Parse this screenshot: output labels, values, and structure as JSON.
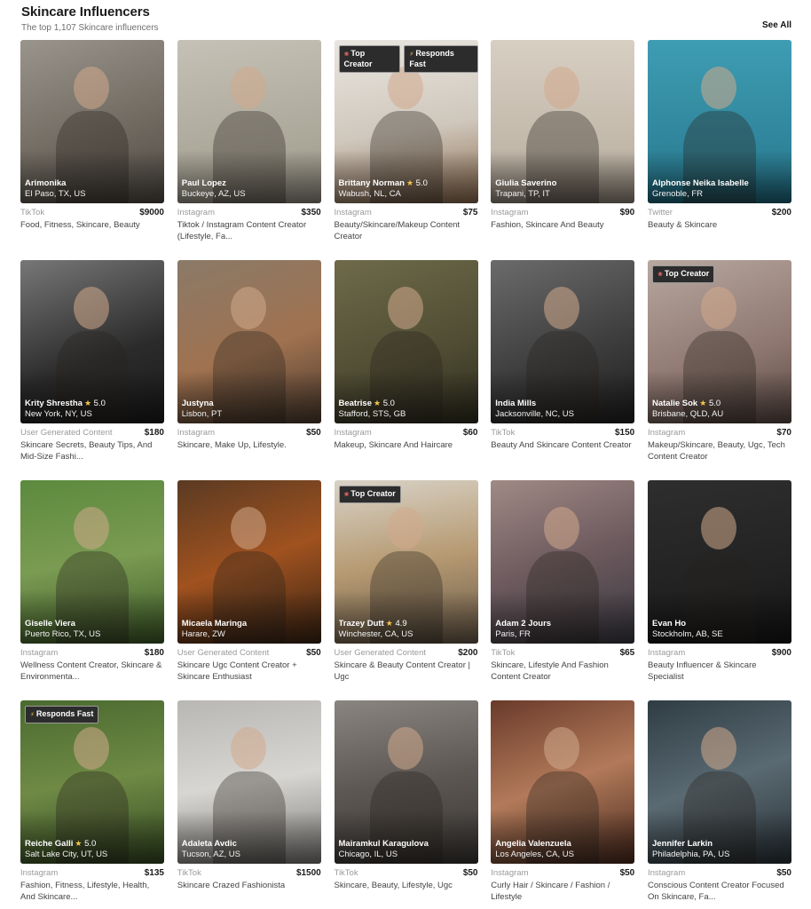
{
  "header": {
    "title": "Skincare Influencers",
    "subtitle": "The top 1,107 Skincare influencers",
    "see_all": "See All"
  },
  "badges": {
    "top_creator": "Top Creator",
    "responds_fast": "Responds Fast"
  },
  "influencers": [
    {
      "name": "Arimonika",
      "rating": "",
      "location": "El Paso, TX, US",
      "platform": "TikTok",
      "price": "$9000",
      "description": "Food, Fitness, Skincare, Beauty",
      "badges": []
    },
    {
      "name": "Paul Lopez",
      "rating": "",
      "location": "Buckeye, AZ, US",
      "platform": "Instagram",
      "price": "$350",
      "description": "Tiktok / Instagram Content Creator (Lifestyle, Fa...",
      "badges": []
    },
    {
      "name": "Brittany Norman",
      "rating": "5.0",
      "location": "Wabush, NL, CA",
      "platform": "Instagram",
      "price": "$75",
      "description": "Beauty/Skincare/Makeup Content Creator",
      "badges": [
        "top_creator",
        "responds_fast"
      ]
    },
    {
      "name": "Giulia Saverino",
      "rating": "",
      "location": "Trapani, TP, IT",
      "platform": "Instagram",
      "price": "$90",
      "description": "Fashion, Skincare And Beauty",
      "badges": []
    },
    {
      "name": "Alphonse Neika Isabelle",
      "rating": "",
      "location": "Grenoble, FR",
      "platform": "Twitter",
      "price": "$200",
      "description": "Beauty & Skincare",
      "badges": []
    },
    {
      "name": "Krity Shrestha",
      "rating": "5.0",
      "location": "New York, NY, US",
      "platform": "User Generated Content",
      "price": "$180",
      "description": "Skincare Secrets, Beauty Tips, And Mid-Size Fashi...",
      "badges": []
    },
    {
      "name": "Justyna",
      "rating": "",
      "location": "Lisbon, PT",
      "platform": "Instagram",
      "price": "$50",
      "description": "Skincare, Make Up, Lifestyle.",
      "badges": []
    },
    {
      "name": "Beatrise",
      "rating": "5.0",
      "location": "Stafford, STS, GB",
      "platform": "Instagram",
      "price": "$60",
      "description": "Makeup, Skincare And Haircare",
      "badges": []
    },
    {
      "name": "India Mills",
      "rating": "",
      "location": "Jacksonville, NC, US",
      "platform": "TikTok",
      "price": "$150",
      "description": "Beauty And Skincare Content Creator",
      "badges": []
    },
    {
      "name": "Natalie Sok",
      "rating": "5.0",
      "location": "Brisbane, QLD, AU",
      "platform": "Instagram",
      "price": "$70",
      "description": "Makeup/Skincare, Beauty, Ugc, Tech Content Creator",
      "badges": [
        "top_creator"
      ]
    },
    {
      "name": "Giselle Viera",
      "rating": "",
      "location": "Puerto Rico, TX, US",
      "platform": "Instagram",
      "price": "$180",
      "description": "Wellness Content Creator, Skincare & Environmenta...",
      "badges": []
    },
    {
      "name": "Micaela Maringa",
      "rating": "",
      "location": "Harare, ZW",
      "platform": "User Generated Content",
      "price": "$50",
      "description": "Skincare Ugc Content Creator + Skincare Enthusiast",
      "badges": []
    },
    {
      "name": "Trazey Dutt",
      "rating": "4.9",
      "location": "Winchester, CA, US",
      "platform": "User Generated Content",
      "price": "$200",
      "description": "Skincare & Beauty Content Creator | Ugc",
      "badges": [
        "top_creator"
      ]
    },
    {
      "name": "Adam 2 Jours",
      "rating": "",
      "location": "Paris, FR",
      "platform": "TikTok",
      "price": "$65",
      "description": "Skincare, Lifestyle And Fashion Content Creator",
      "badges": []
    },
    {
      "name": "Evan Ho",
      "rating": "",
      "location": "Stockholm, AB, SE",
      "platform": "Instagram",
      "price": "$900",
      "description": "Beauty Influencer & Skincare Specialist",
      "badges": []
    },
    {
      "name": "Reiche Galli",
      "rating": "5.0",
      "location": "Salt Lake City, UT, US",
      "platform": "Instagram",
      "price": "$135",
      "description": "Fashion, Fitness, Lifestyle, Health, And Skincare...",
      "badges": [
        "responds_fast"
      ]
    },
    {
      "name": "Adaleta Avdic",
      "rating": "",
      "location": "Tucson, AZ, US",
      "platform": "TikTok",
      "price": "$1500",
      "description": "Skincare Crazed Fashionista",
      "badges": []
    },
    {
      "name": "Mairamkul Karagulova",
      "rating": "",
      "location": "Chicago, IL, US",
      "platform": "TikTok",
      "price": "$50",
      "description": "Skincare, Beauty, Lifestyle, Ugc",
      "badges": []
    },
    {
      "name": "Angelia Valenzuela",
      "rating": "",
      "location": "Los Angeles, CA, US",
      "platform": "Instagram",
      "price": "$50",
      "description": "Curly Hair / Skincare / Fashion / Lifestyle",
      "badges": []
    },
    {
      "name": "Jennifer Larkin",
      "rating": "",
      "location": "Philadelphia, PA, US",
      "platform": "Instagram",
      "price": "$50",
      "description": "Conscious Content Creator Focused On Skincare, Fa...",
      "badges": []
    }
  ],
  "colors": {
    "star": "#f3c54a",
    "badge_bg": "#2c2c2c",
    "muted_text": "#9a9a9a"
  },
  "icons": {
    "star": "star-icon",
    "top_creator": "ribbon-icon",
    "responds_fast": "lightning-icon"
  }
}
